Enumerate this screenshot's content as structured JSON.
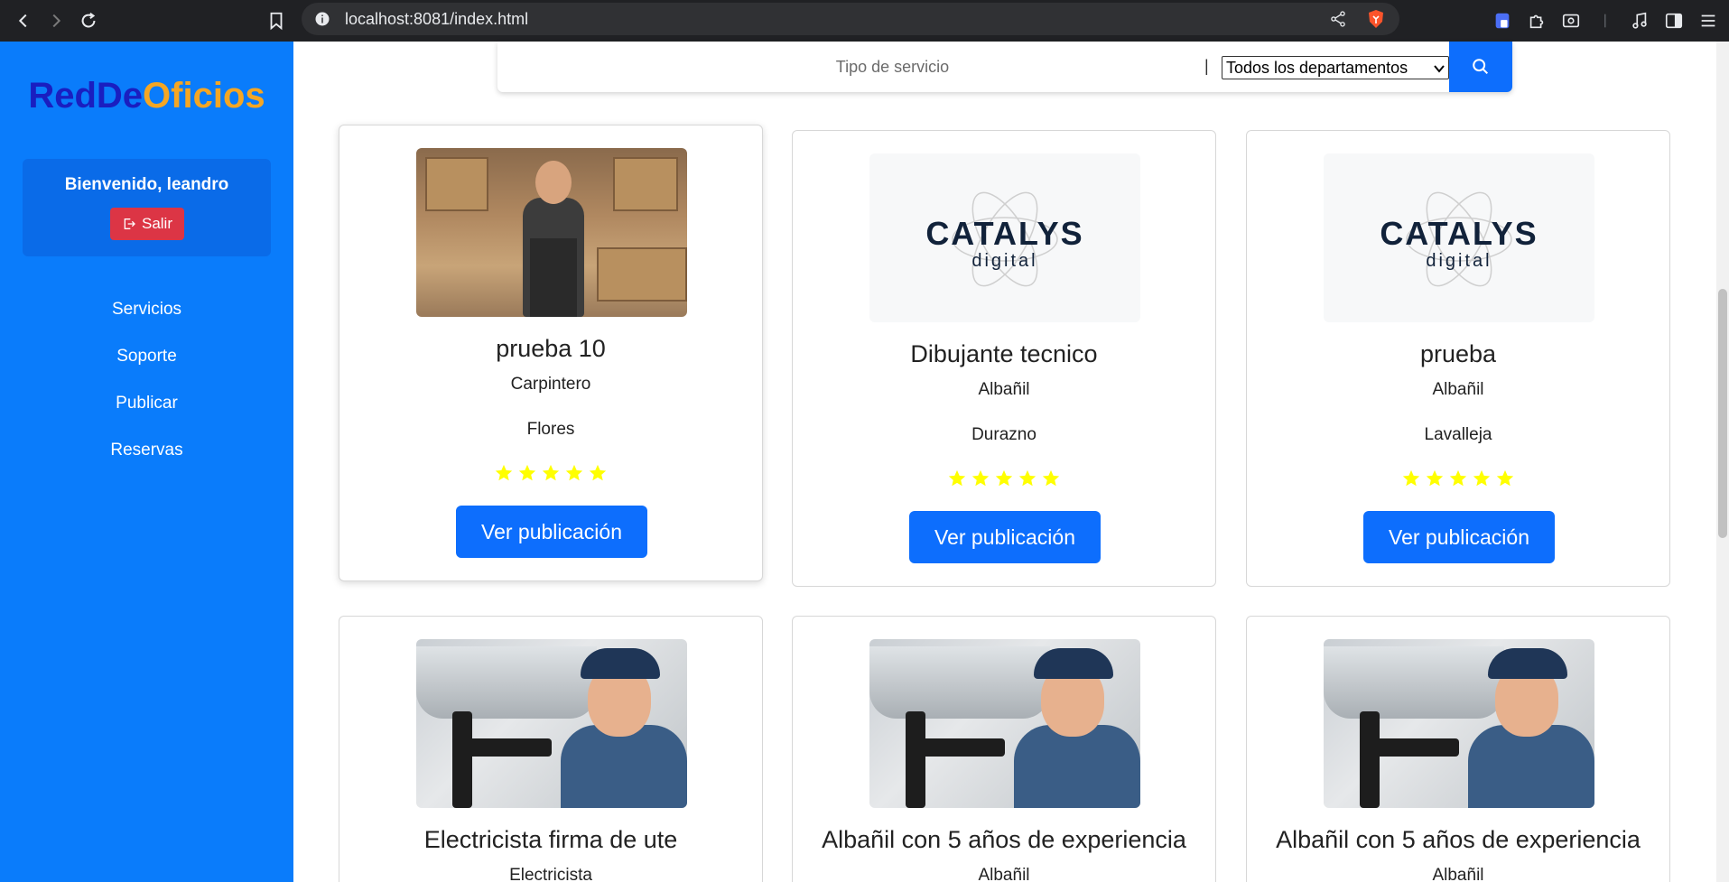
{
  "browser": {
    "url": "localhost:8081/index.html"
  },
  "brand": {
    "part1": "RedDe",
    "part2": "Oficios",
    "color1": "#1a1ec0",
    "color2": "#f5a623"
  },
  "sidebar": {
    "welcome": "Bienvenido, leandro",
    "logout_label": "Salir",
    "items": [
      {
        "label": "Servicios"
      },
      {
        "label": "Soporte"
      },
      {
        "label": "Publicar"
      },
      {
        "label": "Reservas"
      }
    ]
  },
  "search": {
    "placeholder": "Tipo de servicio",
    "separator": "|",
    "department": "Todos los departamentos"
  },
  "cards": [
    {
      "title": "prueba 10",
      "trade": "Carpintero",
      "department": "Flores",
      "rating": 5,
      "image": "kitchen-worker",
      "button": "Ver publicación"
    },
    {
      "title": "Dibujante tecnico",
      "trade": "Albañil",
      "department": "Durazno",
      "rating": 5,
      "image": "catalys-logo",
      "button": "Ver publicación"
    },
    {
      "title": "prueba",
      "trade": "Albañil",
      "department": "Lavalleja",
      "rating": 5,
      "image": "catalys-logo",
      "button": "Ver publicación"
    },
    {
      "title": "Electricista firma de ute",
      "trade": "Electricista",
      "image": "plumber"
    },
    {
      "title": "Albañil con 5 años de experiencia",
      "trade": "Albañil",
      "image": "plumber"
    },
    {
      "title": "Albañil con 5 años de experiencia",
      "trade": "Albañil",
      "image": "plumber"
    }
  ],
  "logo": {
    "word": "CATALYS",
    "sub": "digital"
  },
  "colors": {
    "sidebar": "#0a7cfb",
    "primary": "#0d6efd",
    "danger": "#dc3545",
    "star": "#ffff00"
  }
}
